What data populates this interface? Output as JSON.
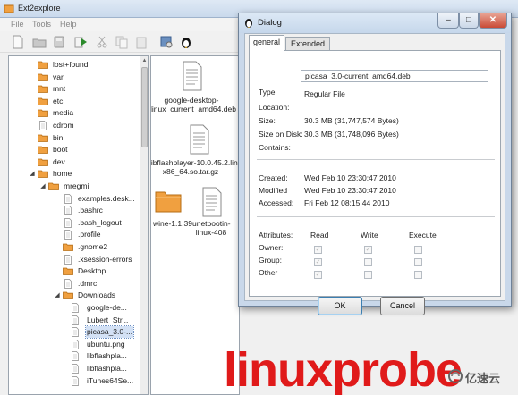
{
  "main_window": {
    "title": "Ext2explore",
    "menu": [
      "File",
      "Tools",
      "Help"
    ],
    "toolbar": [
      "new-icon",
      "open-folder-icon",
      "save-icon",
      "refresh-icon",
      "cut-icon",
      "copy-icon",
      "paste-icon",
      "properties-icon",
      "tux-icon"
    ],
    "tree": [
      {
        "label": "lost+found",
        "type": "folder",
        "depth": 0
      },
      {
        "label": "var",
        "type": "folder",
        "depth": 0
      },
      {
        "label": "mnt",
        "type": "folder",
        "depth": 0
      },
      {
        "label": "etc",
        "type": "folder",
        "depth": 0
      },
      {
        "label": "media",
        "type": "folder",
        "depth": 0
      },
      {
        "label": "cdrom",
        "type": "file",
        "depth": 0
      },
      {
        "label": "bin",
        "type": "folder",
        "depth": 0
      },
      {
        "label": "boot",
        "type": "folder",
        "depth": 0
      },
      {
        "label": "dev",
        "type": "folder",
        "depth": 0
      },
      {
        "label": "home",
        "type": "folder",
        "depth": 0,
        "expanded": true
      },
      {
        "label": "mregmi",
        "type": "folder",
        "depth": 1,
        "expanded": true
      },
      {
        "label": "examples.desk...",
        "type": "file",
        "depth": 2
      },
      {
        "label": ".bashrc",
        "type": "file",
        "depth": 2
      },
      {
        "label": ".bash_logout",
        "type": "file",
        "depth": 2
      },
      {
        "label": ".profile",
        "type": "file",
        "depth": 2
      },
      {
        "label": ".gnome2",
        "type": "folder",
        "depth": 2
      },
      {
        "label": ".xsession-errors",
        "type": "file",
        "depth": 2
      },
      {
        "label": "Desktop",
        "type": "folder",
        "depth": 2
      },
      {
        "label": ".dmrc",
        "type": "file",
        "depth": 2
      },
      {
        "label": "Downloads",
        "type": "folder",
        "depth": 2,
        "expanded": true
      },
      {
        "label": "google-de...",
        "type": "file",
        "depth": 3
      },
      {
        "label": "Lubert_Str...",
        "type": "file",
        "depth": 3
      },
      {
        "label": "picasa_3.0-...",
        "type": "file",
        "depth": 3,
        "selected": true
      },
      {
        "label": "ubuntu.png",
        "type": "file",
        "depth": 3
      },
      {
        "label": "libflashpla...",
        "type": "file",
        "depth": 3
      },
      {
        "label": "libflashpla...",
        "type": "file",
        "depth": 3
      },
      {
        "label": "iTunes64Se...",
        "type": "file",
        "depth": 3
      }
    ],
    "files": [
      {
        "label_lines": [
          "google-desktop-",
          "linux_current_amd64.deb"
        ],
        "type": "doc"
      },
      {
        "label_lines": [
          "libflashplayer-10.0.45.2.linux-",
          "x86_64.so.tar.gz"
        ],
        "type": "doc"
      },
      {
        "label_lines": [
          "wine-1.1.39"
        ],
        "type": "folder"
      },
      {
        "label_lines": [
          "unetbootin-",
          "linux-408"
        ],
        "type": "doc"
      }
    ]
  },
  "dialog": {
    "title": "Dialog",
    "tabs": [
      "general",
      "Extended"
    ],
    "filename": "picasa_3.0-current_amd64.deb",
    "labels": {
      "type": "Type:",
      "location": "Location:",
      "size": "Size:",
      "size_on_disk": "Size on Disk:",
      "contains": "Contains:",
      "created": "Created:",
      "modified": "Modified",
      "accessed": "Accessed:",
      "attributes": "Attributes:"
    },
    "values": {
      "type": "Regular File",
      "location": "",
      "size": "30.3 MB (31,747,574 Bytes)",
      "size_on_disk": "30.3 MB (31,748,096 Bytes)",
      "contains": "",
      "created": "Wed Feb 10 23:30:47 2010",
      "modified": "Wed Feb 10 23:30:47 2010",
      "accessed": "Fri Feb 12 08:15:44 2010"
    },
    "permission_headers": [
      "Read",
      "Write",
      "Execute"
    ],
    "permissions": [
      {
        "who": "Owner:",
        "read": true,
        "write": true,
        "execute": false
      },
      {
        "who": "Group:",
        "read": true,
        "write": false,
        "execute": false
      },
      {
        "who": "Other",
        "read": true,
        "write": false,
        "execute": false
      }
    ],
    "ok_label": "OK",
    "cancel_label": "Cancel",
    "window_buttons": [
      "minimize-icon",
      "maximize-icon",
      "close-icon"
    ]
  },
  "watermark": {
    "text": "linuxprobe",
    "brand": "亿速云"
  },
  "colors": {
    "folder": "#f0a040",
    "selection": "#d3e1f5",
    "watermark": "#e01a1a",
    "dialog_frame": "#c9d8ea"
  }
}
